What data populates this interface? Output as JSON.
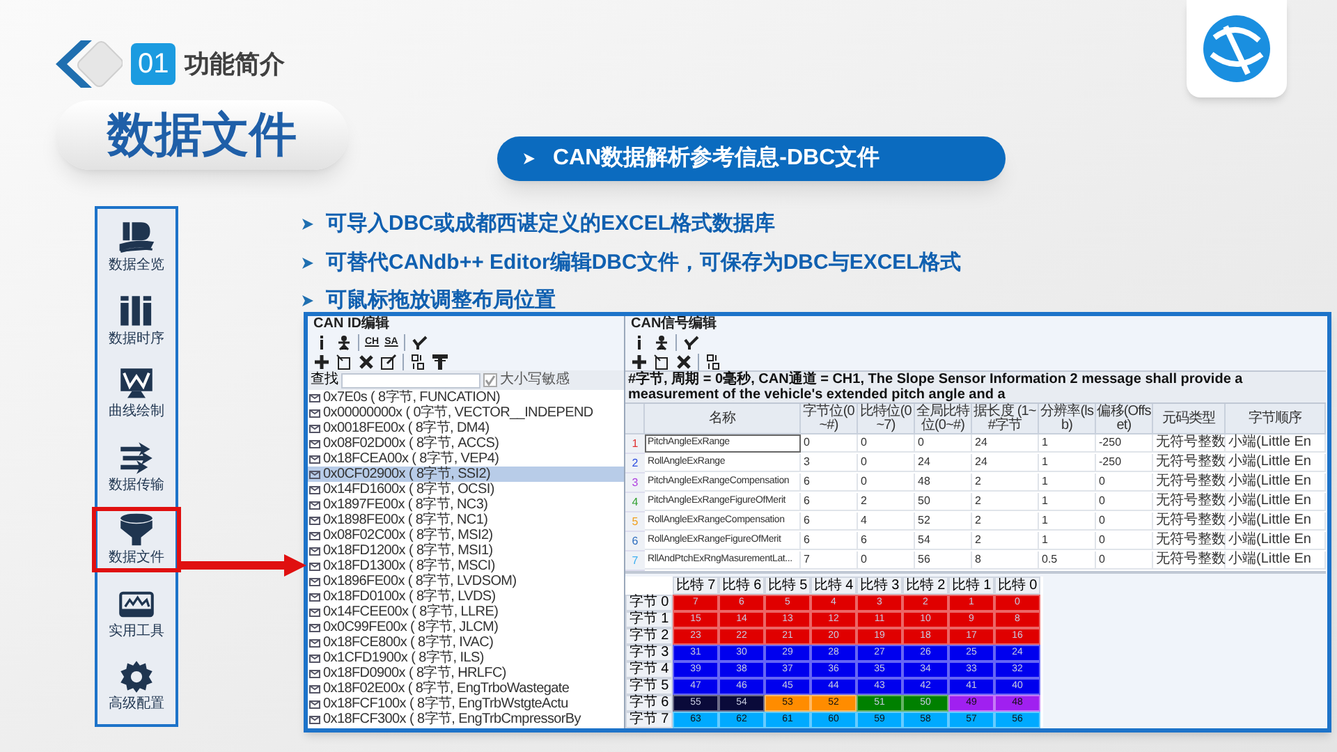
{
  "header": {
    "section_number": "01",
    "section_title": "功能简介"
  },
  "page_title": "数据文件",
  "subtitle": "CAN数据解析参考信息-DBC文件",
  "sidebar": [
    {
      "kind": "overview",
      "label": "数据全览",
      "selected": false
    },
    {
      "kind": "timeline",
      "label": "数据时序",
      "selected": false
    },
    {
      "kind": "curve",
      "label": "曲线绘制",
      "selected": false
    },
    {
      "kind": "transfer",
      "label": "数据传输",
      "selected": false
    },
    {
      "kind": "file",
      "label": "数据文件",
      "selected": true
    },
    {
      "kind": "tools",
      "label": "实用工具",
      "selected": false
    },
    {
      "kind": "settings",
      "label": "高级配置",
      "selected": false
    }
  ],
  "features": [
    "可导入DBC或成都西谌定义的EXCEL格式数据库",
    "可替代CANdb++ Editor编辑DBC文件，可保存为DBC与EXCEL格式",
    "可鼠标拖放调整布局位置"
  ],
  "app": {
    "id_panel": {
      "title": "CAN ID编辑",
      "toolbar": [
        [
          {
            "kind": "info"
          },
          {
            "kind": "person"
          },
          {
            "kind": "sep"
          },
          {
            "kind": "text",
            "label": "CH"
          },
          {
            "kind": "text",
            "label": "SA"
          },
          {
            "kind": "sep"
          },
          {
            "kind": "check"
          }
        ],
        [
          {
            "kind": "add"
          },
          {
            "kind": "tab"
          },
          {
            "kind": "delete"
          },
          {
            "kind": "edit"
          },
          {
            "kind": "sep"
          },
          {
            "kind": "sort"
          },
          {
            "kind": "filter"
          }
        ]
      ],
      "search_label": "查找",
      "case_label": "大小写敏感",
      "case_checked": true,
      "items": [
        {
          "text": "0x7E0s ( 8字节, FUNCATION)",
          "selected": false
        },
        {
          "text": "0x00000000x ( 0字节, VECTOR__INDEPEND",
          "selected": false
        },
        {
          "text": "0x0018FE00x ( 8字节, DM4)",
          "selected": false
        },
        {
          "text": "0x08F02D00x ( 8字节, ACCS)",
          "selected": false
        },
        {
          "text": "0x18FCEA00x ( 8字节, VEP4)",
          "selected": false
        },
        {
          "text": "0x0CF02900x ( 8字节, SSI2)",
          "selected": true
        },
        {
          "text": "0x14FD1600x ( 8字节, OCSI)",
          "selected": false
        },
        {
          "text": "0x1897FE00x ( 8字节, NC3)",
          "selected": false
        },
        {
          "text": "0x1898FE00x ( 8字节, NC1)",
          "selected": false
        },
        {
          "text": "0x08F02C00x ( 8字节, MSI2)",
          "selected": false
        },
        {
          "text": "0x18FD1200x ( 8字节, MSI1)",
          "selected": false
        },
        {
          "text": "0x18FD1300x ( 8字节, MSCI)",
          "selected": false
        },
        {
          "text": "0x1896FE00x ( 8字节, LVDSOM)",
          "selected": false
        },
        {
          "text": "0x18FD0100x ( 8字节, LVDS)",
          "selected": false
        },
        {
          "text": "0x14FCEE00x ( 8字节, LLRE)",
          "selected": false
        },
        {
          "text": "0x0C99FE00x ( 8字节, JLCM)",
          "selected": false
        },
        {
          "text": "0x18FCE800x ( 8字节, IVAC)",
          "selected": false
        },
        {
          "text": "0x1CFD1900x ( 8字节, ILS)",
          "selected": false
        },
        {
          "text": "0x18FD0900x ( 8字节, HRLFC)",
          "selected": false
        },
        {
          "text": "0x18F02E00x ( 8字节, EngTrboWastegate",
          "selected": false
        },
        {
          "text": "0x18FCF100x ( 8字节, EngTrbWstgteActu",
          "selected": false
        },
        {
          "text": "0x18FCF300x ( 8字节, EngTrbCmpressorBy",
          "selected": false
        }
      ]
    },
    "signal_panel": {
      "title": "CAN信号编辑",
      "toolbar": [
        [
          {
            "kind": "info"
          },
          {
            "kind": "person"
          },
          {
            "kind": "sep"
          },
          {
            "kind": "check"
          }
        ],
        [
          {
            "kind": "add"
          },
          {
            "kind": "tab"
          },
          {
            "kind": "delete"
          },
          {
            "kind": "sep"
          },
          {
            "kind": "sort"
          }
        ]
      ],
      "info": "#字节, 周期 = 0毫秒, CAN通道 = CH1, The Slope Sensor Information 2 message shall provide a measurement of the vehicle's extended pitch angle and a",
      "columns": [
        "名称",
        "字节位(0~#)",
        "比特位(0~7)",
        "全局比特位(0~#)",
        "据长度 (1~#字节",
        "分辨率(lsb)",
        "偏移(Offset)",
        "元码类型",
        "字节顺序"
      ],
      "rows": [
        {
          "index": "1",
          "color": "#e03030",
          "selected": true,
          "cells": [
            "PitchAngleExRange",
            "0",
            "0",
            "0",
            "24",
            "1",
            "-250",
            "无符号整数",
            "小端(Little En"
          ]
        },
        {
          "index": "2",
          "color": "#3050e0",
          "selected": false,
          "cells": [
            "RollAngleExRange",
            "3",
            "0",
            "24",
            "24",
            "1",
            "-250",
            "无符号整数",
            "小端(Little En"
          ]
        },
        {
          "index": "3",
          "color": "#b040e0",
          "selected": false,
          "cells": [
            "PitchAngleExRangeCompensation",
            "6",
            "0",
            "48",
            "2",
            "1",
            "0",
            "无符号整数",
            "小端(Little En"
          ]
        },
        {
          "index": "4",
          "color": "#30a030",
          "selected": false,
          "cells": [
            "PitchAngleExRangeFigureOfMerit",
            "6",
            "2",
            "50",
            "2",
            "1",
            "0",
            "无符号整数",
            "小端(Little En"
          ]
        },
        {
          "index": "5",
          "color": "#f0a020",
          "selected": false,
          "cells": [
            "RollAngleExRangeCompensation",
            "6",
            "4",
            "52",
            "2",
            "1",
            "0",
            "无符号整数",
            "小端(Little En"
          ]
        },
        {
          "index": "6",
          "color": "#3070c0",
          "selected": false,
          "cells": [
            "RollAngleExRangeFigureOfMerit",
            "6",
            "6",
            "54",
            "2",
            "1",
            "0",
            "无符号整数",
            "小端(Little En"
          ]
        },
        {
          "index": "7",
          "color": "#40b0f0",
          "selected": false,
          "cells": [
            "RllAndPtchExRngMasurementLat...",
            "7",
            "0",
            "56",
            "8",
            "0.5",
            "0",
            "无符号整数",
            "小端(Little En"
          ]
        }
      ],
      "bit_grid": {
        "columns": [
          "比特 7",
          "比特 6",
          "比特 5",
          "比特 4",
          "比特 3",
          "比特 2",
          "比特 1",
          "比特 0"
        ],
        "rows": [
          {
            "label": "字节 0",
            "cells": [
              {
                "text": "7",
                "color": "#e00000"
              },
              {
                "text": "6",
                "color": "#e00000"
              },
              {
                "text": "5",
                "color": "#e00000"
              },
              {
                "text": "4",
                "color": "#e00000"
              },
              {
                "text": "3",
                "color": "#e00000"
              },
              {
                "text": "2",
                "color": "#e00000"
              },
              {
                "text": "1",
                "color": "#e00000"
              },
              {
                "text": "0",
                "color": "#e00000"
              }
            ]
          },
          {
            "label": "字节 1",
            "cells": [
              {
                "text": "15",
                "color": "#e00000"
              },
              {
                "text": "14",
                "color": "#e00000"
              },
              {
                "text": "13",
                "color": "#e00000"
              },
              {
                "text": "12",
                "color": "#e00000"
              },
              {
                "text": "11",
                "color": "#e00000"
              },
              {
                "text": "10",
                "color": "#e00000"
              },
              {
                "text": "9",
                "color": "#e00000"
              },
              {
                "text": "8",
                "color": "#e00000"
              }
            ]
          },
          {
            "label": "字节 2",
            "cells": [
              {
                "text": "23",
                "color": "#e00000"
              },
              {
                "text": "22",
                "color": "#e00000"
              },
              {
                "text": "21",
                "color": "#e00000"
              },
              {
                "text": "20",
                "color": "#e00000"
              },
              {
                "text": "19",
                "color": "#e00000"
              },
              {
                "text": "18",
                "color": "#e00000"
              },
              {
                "text": "17",
                "color": "#e00000"
              },
              {
                "text": "16",
                "color": "#e00000"
              }
            ]
          },
          {
            "label": "字节 3",
            "cells": [
              {
                "text": "31",
                "color": "#0000ee"
              },
              {
                "text": "30",
                "color": "#0000ee"
              },
              {
                "text": "29",
                "color": "#0000ee"
              },
              {
                "text": "28",
                "color": "#0000ee"
              },
              {
                "text": "27",
                "color": "#0000ee"
              },
              {
                "text": "26",
                "color": "#0000ee"
              },
              {
                "text": "25",
                "color": "#0000ee"
              },
              {
                "text": "24",
                "color": "#0000ee"
              }
            ]
          },
          {
            "label": "字节 4",
            "cells": [
              {
                "text": "39",
                "color": "#0000ee"
              },
              {
                "text": "38",
                "color": "#0000ee"
              },
              {
                "text": "37",
                "color": "#0000ee"
              },
              {
                "text": "36",
                "color": "#0000ee"
              },
              {
                "text": "35",
                "color": "#0000ee"
              },
              {
                "text": "34",
                "color": "#0000ee"
              },
              {
                "text": "33",
                "color": "#0000ee"
              },
              {
                "text": "32",
                "color": "#0000ee"
              }
            ]
          },
          {
            "label": "字节 5",
            "cells": [
              {
                "text": "47",
                "color": "#0000ee"
              },
              {
                "text": "46",
                "color": "#0000ee"
              },
              {
                "text": "45",
                "color": "#0000ee"
              },
              {
                "text": "44",
                "color": "#0000ee"
              },
              {
                "text": "43",
                "color": "#0000ee"
              },
              {
                "text": "42",
                "color": "#0000ee"
              },
              {
                "text": "41",
                "color": "#0000ee"
              },
              {
                "text": "40",
                "color": "#0000ee"
              }
            ]
          },
          {
            "label": "字节 6",
            "cells": [
              {
                "text": "55",
                "color": "#0a0a3a"
              },
              {
                "text": "54",
                "color": "#0a0a3a"
              },
              {
                "text": "53",
                "color": "#ff8c00"
              },
              {
                "text": "52",
                "color": "#ff8c00"
              },
              {
                "text": "51",
                "color": "#008000"
              },
              {
                "text": "50",
                "color": "#008000"
              },
              {
                "text": "49",
                "color": "#a020f0"
              },
              {
                "text": "48",
                "color": "#a020f0"
              }
            ]
          },
          {
            "label": "字节 7",
            "cells": [
              {
                "text": "63",
                "color": "#00aaff"
              },
              {
                "text": "62",
                "color": "#00aaff"
              },
              {
                "text": "61",
                "color": "#00aaff"
              },
              {
                "text": "60",
                "color": "#00aaff"
              },
              {
                "text": "59",
                "color": "#00aaff"
              },
              {
                "text": "58",
                "color": "#00aaff"
              },
              {
                "text": "57",
                "color": "#00aaff"
              },
              {
                "text": "56",
                "color": "#00aaff"
              }
            ]
          }
        ]
      }
    }
  }
}
